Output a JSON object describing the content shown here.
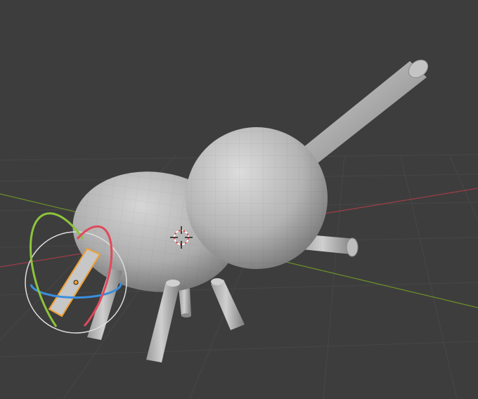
{
  "viewport": {
    "background": "#3d3d3d",
    "grid_color": "#4a4a4a",
    "axis_x_color": "#9b3d49",
    "axis_y_color": "#6b8e2a"
  },
  "object": {
    "material_color": "#b9b9b9",
    "selected_outline_color": "#f0a030",
    "parts": [
      "body",
      "head",
      "antenna",
      "arm",
      "front-leg",
      "mid-leg",
      "back-leg",
      "selected-leg"
    ]
  },
  "gizmo": {
    "mode": "rotate",
    "colors": {
      "x": "#e04a5a",
      "y": "#8cc43c",
      "z": "#3b8fdc",
      "view": "#dddddd"
    }
  },
  "cursor_3d": {
    "icon": "3d-cursor-icon"
  }
}
